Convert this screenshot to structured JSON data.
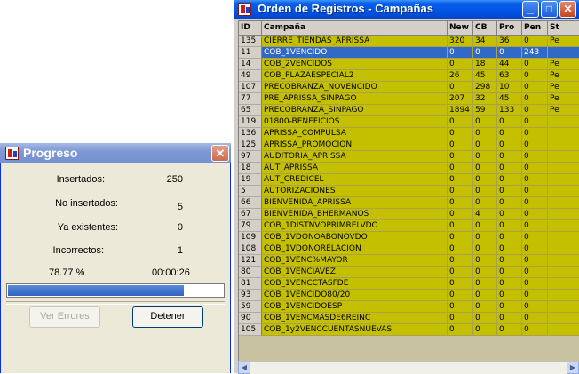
{
  "main_window": {
    "title": "Orden de Registros - Campañas",
    "columns": [
      "ID",
      "Campaña",
      "New",
      "CB",
      "Pro",
      "Pen",
      "St"
    ],
    "rows": [
      {
        "id": "135",
        "campaign": "CIERRE_TIENDAS_APRISSA",
        "new": "320",
        "cb": "34",
        "pro": "36",
        "pen": "0",
        "st": "Pe"
      },
      {
        "id": "11",
        "campaign": "COB_1VENCIDO",
        "new": "0",
        "cb": "0",
        "pro": "0",
        "pen": "243",
        "st": ""
      },
      {
        "id": "14",
        "campaign": "COB_2VENCIDOS",
        "new": "0",
        "cb": "18",
        "pro": "44",
        "pen": "0",
        "st": "Pe"
      },
      {
        "id": "49",
        "campaign": "COB_PLAZAESPECIAL2",
        "new": "26",
        "cb": "45",
        "pro": "63",
        "pen": "0",
        "st": "Pe"
      },
      {
        "id": "107",
        "campaign": "PRECOBRANZA_NOVENCIDO",
        "new": "0",
        "cb": "298",
        "pro": "10",
        "pen": "0",
        "st": "Pe"
      },
      {
        "id": "77",
        "campaign": "PRE_APRISSA_SINPAGO",
        "new": "207",
        "cb": "32",
        "pro": "45",
        "pen": "0",
        "st": "Pe"
      },
      {
        "id": "65",
        "campaign": "PRECOBRANZA_SINPAGO",
        "new": "1894",
        "cb": "59",
        "pro": "133",
        "pen": "0",
        "st": "Pe"
      },
      {
        "id": "119",
        "campaign": "01800-BENEFICIOS",
        "new": "0",
        "cb": "0",
        "pro": "0",
        "pen": "0",
        "st": ""
      },
      {
        "id": "136",
        "campaign": "APRISSA_COMPULSA",
        "new": "0",
        "cb": "0",
        "pro": "0",
        "pen": "0",
        "st": ""
      },
      {
        "id": "125",
        "campaign": "APRISSA_PROMOCION",
        "new": "0",
        "cb": "0",
        "pro": "0",
        "pen": "0",
        "st": ""
      },
      {
        "id": "97",
        "campaign": "AUDITORIA_APRISSA",
        "new": "0",
        "cb": "0",
        "pro": "0",
        "pen": "0",
        "st": ""
      },
      {
        "id": "18",
        "campaign": "AUT_APRISSA",
        "new": "0",
        "cb": "0",
        "pro": "0",
        "pen": "0",
        "st": ""
      },
      {
        "id": "19",
        "campaign": "AUT_CREDICEL",
        "new": "0",
        "cb": "0",
        "pro": "0",
        "pen": "0",
        "st": ""
      },
      {
        "id": "5",
        "campaign": "AUTORIZACIONES",
        "new": "0",
        "cb": "0",
        "pro": "0",
        "pen": "0",
        "st": ""
      },
      {
        "id": "66",
        "campaign": "BIENVENIDA_APRISSA",
        "new": "0",
        "cb": "0",
        "pro": "0",
        "pen": "0",
        "st": ""
      },
      {
        "id": "67",
        "campaign": "BIENVENIDA_BHERMANOS",
        "new": "0",
        "cb": "4",
        "pro": "0",
        "pen": "0",
        "st": ""
      },
      {
        "id": "79",
        "campaign": "COB_1DISTNVOPRIMRELVDO",
        "new": "0",
        "cb": "0",
        "pro": "0",
        "pen": "0",
        "st": ""
      },
      {
        "id": "109",
        "campaign": "COB_1VDONOABONOVDO",
        "new": "0",
        "cb": "0",
        "pro": "0",
        "pen": "0",
        "st": ""
      },
      {
        "id": "108",
        "campaign": "COB_1VDONORELACION",
        "new": "0",
        "cb": "0",
        "pro": "0",
        "pen": "0",
        "st": ""
      },
      {
        "id": "121",
        "campaign": "COB_1VENC%MAYOR",
        "new": "0",
        "cb": "0",
        "pro": "0",
        "pen": "0",
        "st": ""
      },
      {
        "id": "80",
        "campaign": "COB_1VENCIAVEZ",
        "new": "0",
        "cb": "0",
        "pro": "0",
        "pen": "0",
        "st": ""
      },
      {
        "id": "81",
        "campaign": "COB_1VENCCTASFDE",
        "new": "0",
        "cb": "0",
        "pro": "0",
        "pen": "0",
        "st": ""
      },
      {
        "id": "93",
        "campaign": "COB_1VENCIDO80/20",
        "new": "0",
        "cb": "0",
        "pro": "0",
        "pen": "0",
        "st": ""
      },
      {
        "id": "59",
        "campaign": "COB_1VENCIDOESP",
        "new": "0",
        "cb": "0",
        "pro": "0",
        "pen": "0",
        "st": ""
      },
      {
        "id": "90",
        "campaign": "COB_1VENCMASDE6REINC",
        "new": "0",
        "cb": "0",
        "pro": "0",
        "pen": "0",
        "st": ""
      },
      {
        "id": "105",
        "campaign": "COB_1y2VENCCUENTASNUEVAS",
        "new": "0",
        "cb": "0",
        "pro": "0",
        "pen": "0",
        "st": ""
      }
    ],
    "selected_row": 1
  },
  "progress_dialog": {
    "title": "Progreso",
    "labels": {
      "insertados": "Insertados:",
      "no_insertados": "No insertados:",
      "ya_existentes": "Ya existentes:",
      "incorrectos": "Incorrectos:"
    },
    "values": {
      "insertados": "250",
      "no_insertados": "5",
      "ya_existentes": "0",
      "incorrectos": "1"
    },
    "percent_text": "78.77 %",
    "elapsed_time": "00:00:26",
    "progress_fraction": 0.8177,
    "buttons": {
      "ver_errores": "Ver Errores",
      "detener": "Detener"
    }
  },
  "colors": {
    "grid_cell": "#c4c000",
    "selection": "#3169c6",
    "titlebar_active": "#0055e5",
    "titlebar_inactive": "#7f98d4",
    "progress_fill": "#2f63c2"
  }
}
